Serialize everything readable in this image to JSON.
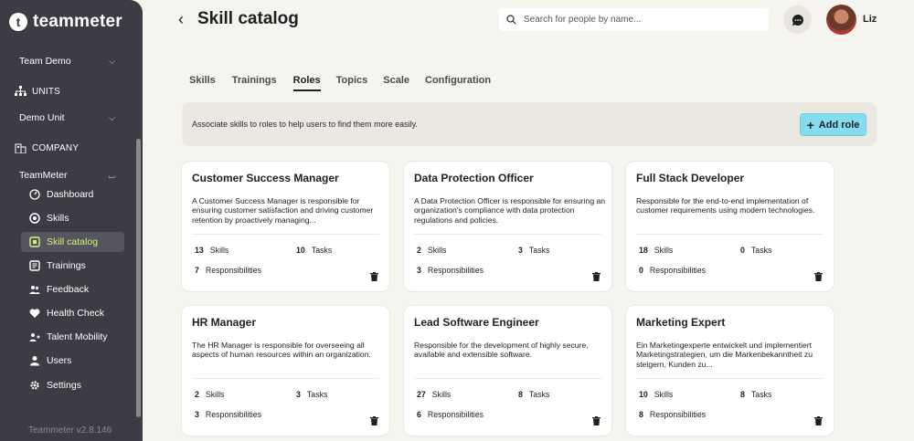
{
  "sidebar": {
    "logo_mark": "t",
    "logo_text": "teammeter",
    "team_select": "Team Demo",
    "units_label": "UNITS",
    "unit_select": "Demo Unit",
    "company_label": "COMPANY",
    "company_select": "TeamMeter",
    "items": [
      {
        "label": "Dashboard",
        "icon": "dashboard-icon"
      },
      {
        "label": "Skills",
        "icon": "target-icon"
      },
      {
        "label": "Skill catalog",
        "icon": "catalog-icon"
      },
      {
        "label": "Trainings",
        "icon": "trainings-icon"
      },
      {
        "label": "Feedback",
        "icon": "feedback-icon"
      },
      {
        "label": "Health Check",
        "icon": "heart-icon"
      },
      {
        "label": "Talent Mobility",
        "icon": "mobility-icon"
      },
      {
        "label": "Users",
        "icon": "users-icon"
      },
      {
        "label": "Settings",
        "icon": "gear-icon"
      }
    ],
    "active_item": "Skill catalog",
    "version": "Teammeter v2.8.146"
  },
  "header": {
    "title": "Skill catalog",
    "search_placeholder": "Search for people by name...",
    "user_name": "Liz"
  },
  "tabs": [
    "Skills",
    "Trainings",
    "Roles",
    "Topics",
    "Scale",
    "Configuration"
  ],
  "active_tab": "Roles",
  "info_text": "Associate skills to roles to help users to find them more easily.",
  "add_role_label": "Add role",
  "labels": {
    "skills": "Skills",
    "tasks": "Tasks",
    "responsibilities": "Responsibilities"
  },
  "roles": [
    {
      "title": "Customer Success Manager",
      "desc": "A Customer Success Manager is responsible for ensuring customer satisfaction and driving customer retention by proactively managing...",
      "skills": "13",
      "tasks": "10",
      "responsibilities": "7"
    },
    {
      "title": "Data Protection Officer",
      "desc": "A Data Protection Officer is responsible for ensuring an organization's compliance with data protection regulations and policies.",
      "skills": "2",
      "tasks": "3",
      "responsibilities": "3"
    },
    {
      "title": "Full Stack Developer",
      "desc": "Responsible for the end-to-end implementation of customer requirements using modern technologies.",
      "skills": "18",
      "tasks": "0",
      "responsibilities": "0"
    },
    {
      "title": "HR Manager",
      "desc": "The HR Manager is responsible for overseeing all aspects of human resources within an organization.",
      "skills": "2",
      "tasks": "3",
      "responsibilities": "3"
    },
    {
      "title": "Lead Software Engineer",
      "desc": "Responsible for the development of highly secure, available and extensible software.",
      "skills": "27",
      "tasks": "8",
      "responsibilities": "6"
    },
    {
      "title": "Marketing Expert",
      "desc": "Ein Marketingexperte entwickelt und implementiert Marketingstrategien, um die Markenbekanntheit zu steigern, Kunden zu...",
      "skills": "10",
      "tasks": "8",
      "responsibilities": "8"
    }
  ],
  "colors": {
    "sidebar": "#3c3c44",
    "accent": "#86dcef",
    "active_text": "#d8f07a"
  }
}
